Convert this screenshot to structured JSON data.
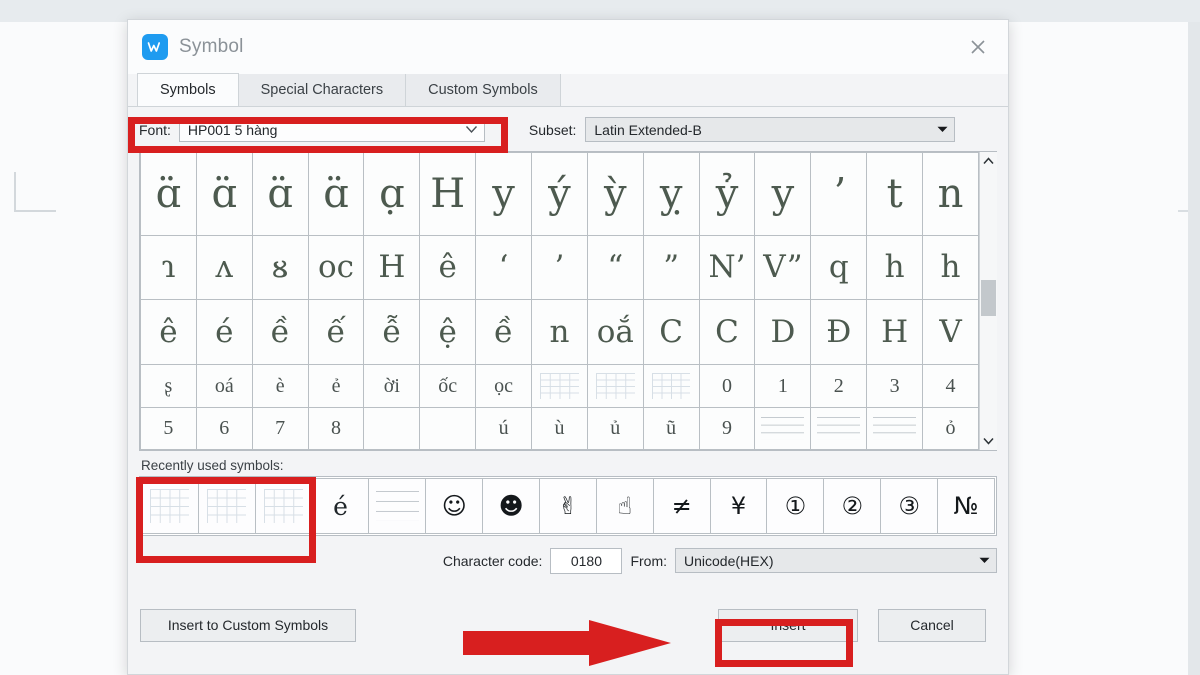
{
  "window": {
    "title": "Symbol",
    "app_icon": "wps-writer-icon",
    "close_label": "×"
  },
  "tabs": [
    {
      "label": "Symbols",
      "active": true
    },
    {
      "label": "Special Characters",
      "active": false
    },
    {
      "label": "Custom Symbols",
      "active": false
    }
  ],
  "selectors": {
    "font_label": "Font:",
    "font_value": "HP001 5 hàng",
    "subset_label": "Subset:",
    "subset_value": "Latin Extended-B"
  },
  "symbol_grid": {
    "columns": 15,
    "rows": [
      [
        "ɑ̈",
        "ɑ̈",
        "ɑ̈",
        "ɑ̈",
        "ɑ̣",
        "H",
        "y",
        "ý",
        "ỳ",
        "ỵ",
        "ỷ",
        "y",
        "ʼ",
        "t",
        "n"
      ],
      [
        "ɿ",
        "ᴧ",
        "ᴕ",
        "oc",
        "H",
        "ê",
        "‘",
        "’",
        "“",
        "”",
        "N’",
        "V”",
        "q",
        "h",
        "h"
      ],
      [
        "ê",
        "é",
        "ề",
        "ế",
        "ễ",
        "ệ",
        "ề",
        "n",
        "oắ",
        "C",
        "C",
        "D",
        "Đ",
        "H",
        "V"
      ],
      [
        "ʂ",
        "oá",
        "è",
        "ẻ",
        "ời",
        "ốc",
        "ọc",
        "__graph__",
        "__graph__",
        "__graph__",
        "0",
        "1",
        "2",
        "3",
        "4"
      ],
      [
        "5",
        "6",
        "7",
        "8",
        "",
        "",
        "ú",
        "ù",
        "ủ",
        "ũ",
        "9",
        "__lines__",
        "__lines__",
        "__lines__",
        "ỏ"
      ]
    ]
  },
  "recent": {
    "label": "Recently used symbols:",
    "items": [
      "__graph__",
      "__graph__",
      "__graph__",
      "é",
      "__lines__",
      "☺",
      "☻",
      "✌",
      "☝",
      "≠",
      "¥",
      "①",
      "②",
      "③",
      "№"
    ]
  },
  "charcode": {
    "label": "Character code:",
    "value": "0180",
    "from_label": "From:",
    "from_value": "Unicode(HEX)"
  },
  "footer": {
    "insert_custom_label": "Insert to Custom Symbols",
    "insert_label": "Insert",
    "cancel_label": "Cancel"
  },
  "annotations": {
    "highlight_color": "#d81f1f",
    "arrow_color": "#d81f1f",
    "boxes": [
      "font-field",
      "recently-used-first-cells",
      "insert-button"
    ]
  }
}
